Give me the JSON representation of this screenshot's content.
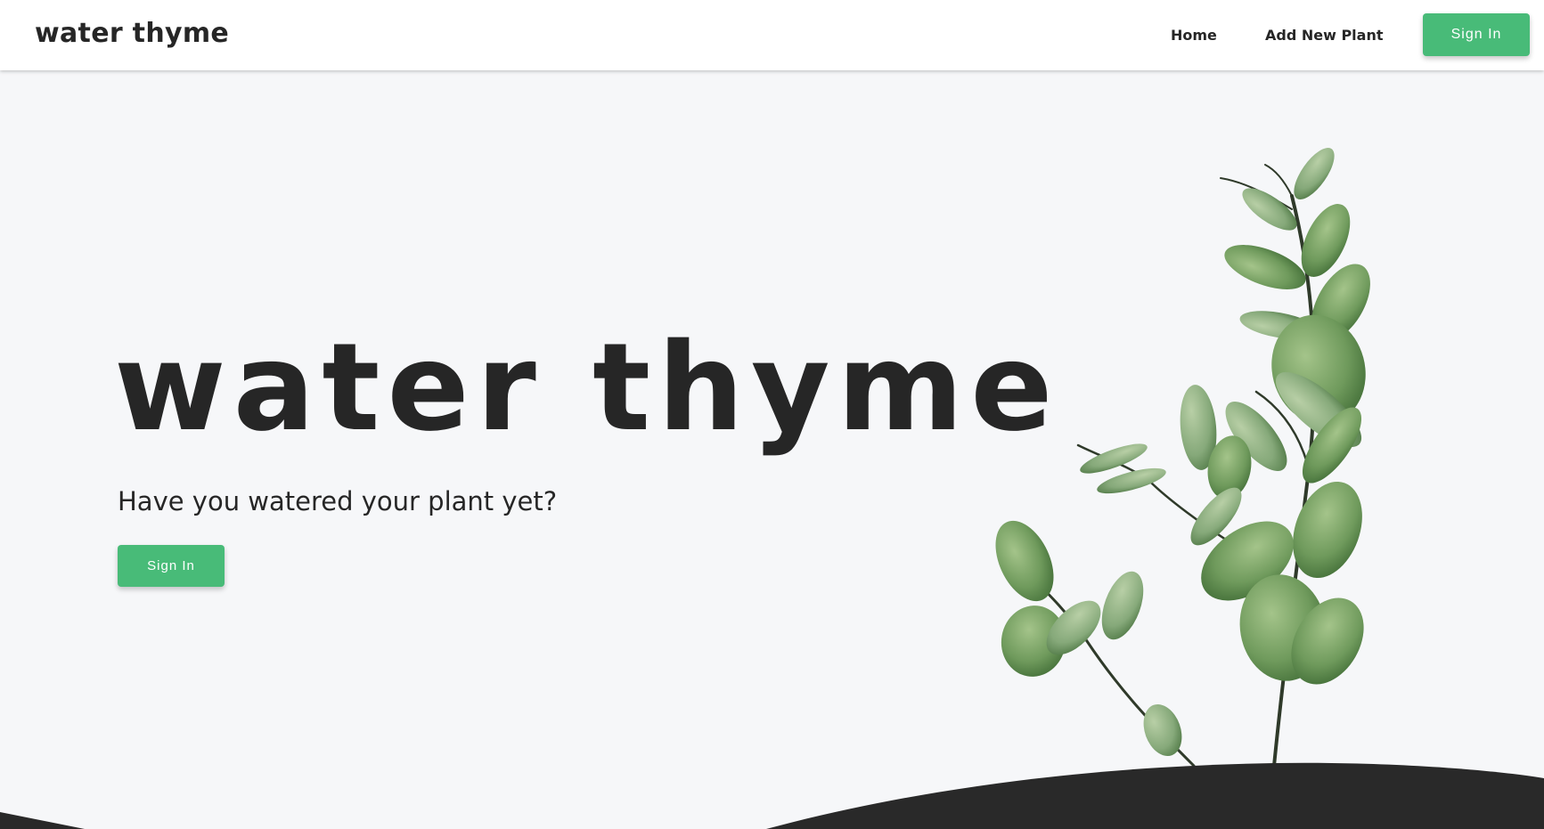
{
  "header": {
    "brand": "water thyme",
    "nav": {
      "home_label": "Home",
      "add_plant_label": "Add New Plant"
    },
    "sign_in_label": "Sign In"
  },
  "hero": {
    "title": "water thyme",
    "subtitle": "Have you watered your plant yet?",
    "sign_in_label": "Sign In"
  },
  "colors": {
    "accent": "#48bb78",
    "text": "#262626",
    "background": "#f6f7f9",
    "footer_wave": "#292929",
    "leaf_light": "#8fb07a",
    "leaf_dark": "#3e6a34"
  },
  "images": {
    "hero_plant": "eucalyptus-plant-illustration"
  }
}
